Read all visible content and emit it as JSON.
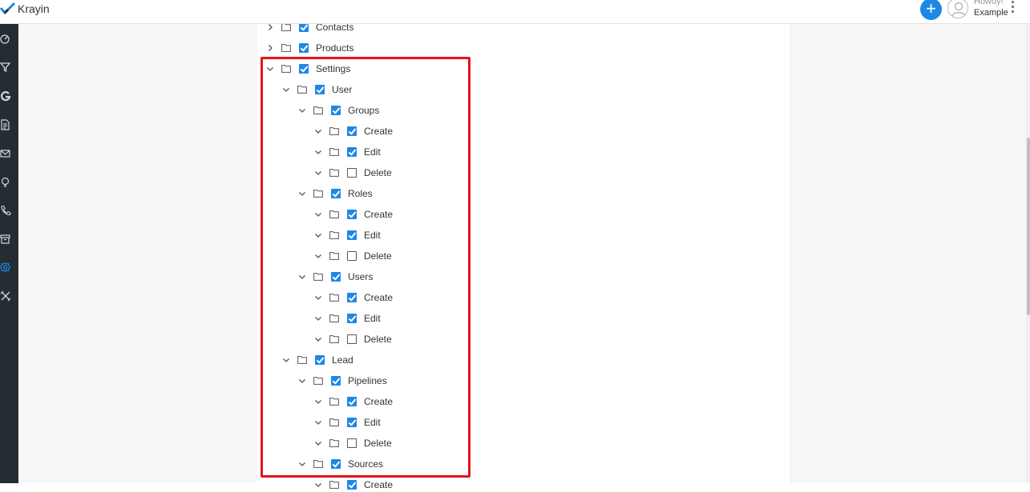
{
  "app": {
    "name": "Krayin",
    "accent": "#1e88e5",
    "highlight_color": "#e3141b"
  },
  "header": {
    "greeting": "Howdy!",
    "user_name": "Example",
    "add_icon": "plus-icon",
    "menu_icon": "kebab-icon"
  },
  "sidebar": {
    "items": [
      {
        "icon": "dashboard-icon"
      },
      {
        "icon": "filter-icon"
      },
      {
        "icon": "google-icon"
      },
      {
        "icon": "document-icon"
      },
      {
        "icon": "mail-icon"
      },
      {
        "icon": "lightbulb-icon"
      },
      {
        "icon": "phone-icon"
      },
      {
        "icon": "archive-icon"
      },
      {
        "icon": "settings-icon",
        "active": true
      },
      {
        "icon": "tools-icon"
      }
    ]
  },
  "tree": [
    {
      "label": "Contacts",
      "depth": 0,
      "expanded": false,
      "checked": true
    },
    {
      "label": "Products",
      "depth": 0,
      "expanded": false,
      "checked": true
    },
    {
      "label": "Settings",
      "depth": 0,
      "expanded": true,
      "checked": true
    },
    {
      "label": "User",
      "depth": 1,
      "expanded": true,
      "checked": true
    },
    {
      "label": "Groups",
      "depth": 2,
      "expanded": true,
      "checked": true
    },
    {
      "label": "Create",
      "depth": 3,
      "expanded": true,
      "checked": true
    },
    {
      "label": "Edit",
      "depth": 3,
      "expanded": true,
      "checked": true
    },
    {
      "label": "Delete",
      "depth": 3,
      "expanded": true,
      "checked": false
    },
    {
      "label": "Roles",
      "depth": 2,
      "expanded": true,
      "checked": true
    },
    {
      "label": "Create",
      "depth": 3,
      "expanded": true,
      "checked": true
    },
    {
      "label": "Edit",
      "depth": 3,
      "expanded": true,
      "checked": true
    },
    {
      "label": "Delete",
      "depth": 3,
      "expanded": true,
      "checked": false
    },
    {
      "label": "Users",
      "depth": 2,
      "expanded": true,
      "checked": true
    },
    {
      "label": "Create",
      "depth": 3,
      "expanded": true,
      "checked": true
    },
    {
      "label": "Edit",
      "depth": 3,
      "expanded": true,
      "checked": true
    },
    {
      "label": "Delete",
      "depth": 3,
      "expanded": true,
      "checked": false
    },
    {
      "label": "Lead",
      "depth": 1,
      "expanded": true,
      "checked": true
    },
    {
      "label": "Pipelines",
      "depth": 2,
      "expanded": true,
      "checked": true
    },
    {
      "label": "Create",
      "depth": 3,
      "expanded": true,
      "checked": true
    },
    {
      "label": "Edit",
      "depth": 3,
      "expanded": true,
      "checked": true
    },
    {
      "label": "Delete",
      "depth": 3,
      "expanded": true,
      "checked": false
    },
    {
      "label": "Sources",
      "depth": 2,
      "expanded": true,
      "checked": true
    },
    {
      "label": "Create",
      "depth": 3,
      "expanded": true,
      "checked": true
    }
  ]
}
